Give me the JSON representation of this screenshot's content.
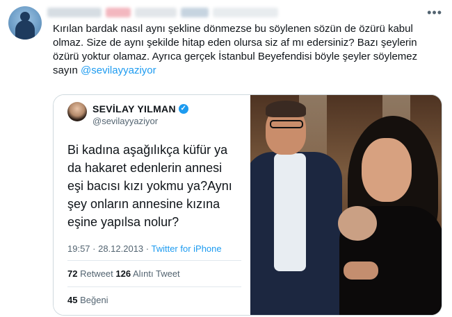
{
  "tweet": {
    "text_before_mention": "Kırılan bardak nasıl aynı şekline dönmezse bu söylenen sözün de özürü kabul olmaz. Size de aynı şekilde hitap eden olursa siz af mı edersiniz? Bazı şeylerin özürü yoktur olamaz. Ayrıca gerçek İstanbul Beyefendisi böyle şeyler söylemez sayın ",
    "mention": "@sevilayyaziyor",
    "more_icon": "•••"
  },
  "quoted_tweet": {
    "display_name": "SEVİLAY YILMAN",
    "verified_icon": "✓",
    "handle": "@sevilayyaziyor",
    "text": "Bi kadına aşağılıkça küfür ya da hakaret edenlerin annesi eşi bacısı kızı yokmu ya?Aynı şey onların annesine kızına eşine yapılsa nolur?",
    "time": "19:57 · 28.12.2013 · ",
    "source": "Twitter for iPhone",
    "retweet_count": "72",
    "retweet_label": " Retweet ",
    "quote_count": "126",
    "quote_label": " Alıntı Tweet",
    "like_count": "45",
    "like_label": " Beğeni"
  },
  "colors": {
    "accent": "#1d9bf0",
    "text": "#0f1419",
    "secondary": "#536471"
  },
  "icons": {
    "more": "more-horizontal-icon",
    "verified": "verified-badge-icon"
  }
}
